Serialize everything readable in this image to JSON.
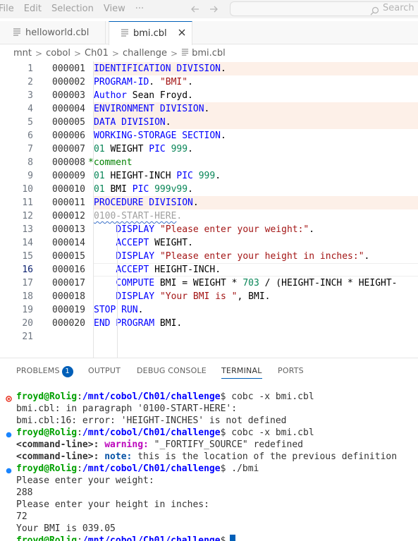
{
  "menu": {
    "items": [
      "File",
      "Edit",
      "Selection",
      "View",
      "···"
    ]
  },
  "search": {
    "placeholder": "Search"
  },
  "tabs": [
    {
      "label": "helloworld.cbl",
      "active": false
    },
    {
      "label": "bmi.cbl",
      "active": true
    }
  ],
  "breadcrumb": [
    "mnt",
    "cobol",
    "Ch01",
    "challenge",
    "bmi.cbl"
  ],
  "editor": {
    "current_line": 16,
    "lines": [
      {
        "n": "1",
        "seq": "000001",
        "segs": [
          [
            "k",
            "IDENTIFICATION DIVISION"
          ],
          [
            "t",
            "."
          ]
        ],
        "hl": true
      },
      {
        "n": "2",
        "seq": "000002",
        "segs": [
          [
            "k",
            "PROGRAM-ID"
          ],
          [
            "t",
            "."
          ],
          [
            "t",
            " "
          ],
          [
            "s",
            "\"BMI\""
          ],
          [
            "t",
            "."
          ]
        ],
        "hl": false
      },
      {
        "n": "3",
        "seq": "000003",
        "segs": [
          [
            "k",
            "Author"
          ],
          [
            "t",
            " Sean Froyd."
          ]
        ],
        "hl": false
      },
      {
        "n": "4",
        "seq": "000004",
        "segs": [
          [
            "k",
            "ENVIRONMENT DIVISION"
          ],
          [
            "t",
            "."
          ]
        ],
        "hl": true
      },
      {
        "n": "5",
        "seq": "000005",
        "segs": [
          [
            "k",
            "DATA DIVISION"
          ],
          [
            "t",
            "."
          ]
        ],
        "hl": true
      },
      {
        "n": "6",
        "seq": "000006",
        "segs": [
          [
            "k",
            "WORKING-STORAGE SECTION"
          ],
          [
            "t",
            "."
          ]
        ],
        "hl": false
      },
      {
        "n": "7",
        "seq": "000007",
        "segs": [
          [
            "n",
            "01"
          ],
          [
            "t",
            " WEIGHT "
          ],
          [
            "k",
            "PIC"
          ],
          [
            "t",
            " "
          ],
          [
            "n",
            "999"
          ],
          [
            "t",
            "."
          ]
        ],
        "hl": false
      },
      {
        "n": "8",
        "seq": "000008",
        "segs": [
          [
            "c",
            "*comment"
          ]
        ],
        "hl": false,
        "comment": true
      },
      {
        "n": "9",
        "seq": "000009",
        "segs": [
          [
            "n",
            "01"
          ],
          [
            "t",
            " HEIGHT-INCH "
          ],
          [
            "k",
            "PIC"
          ],
          [
            "t",
            " "
          ],
          [
            "n",
            "999"
          ],
          [
            "t",
            "."
          ]
        ],
        "hl": false
      },
      {
        "n": "10",
        "seq": "000010",
        "segs": [
          [
            "n",
            "01"
          ],
          [
            "t",
            " BMI "
          ],
          [
            "k",
            "PIC"
          ],
          [
            "t",
            " "
          ],
          [
            "n",
            "999v99"
          ],
          [
            "t",
            "."
          ]
        ],
        "hl": false
      },
      {
        "n": "11",
        "seq": "000011",
        "segs": [
          [
            "k",
            "PROCEDURE DIVISION"
          ],
          [
            "t",
            "."
          ]
        ],
        "hl": true
      },
      {
        "n": "12",
        "seq": "000012",
        "segs": [
          [
            "gq",
            "0100-START-HERE"
          ],
          [
            "g",
            "."
          ]
        ],
        "hl": false
      },
      {
        "n": "13",
        "seq": "000013",
        "segs": [
          [
            "t",
            "    "
          ],
          [
            "k",
            "DISPLAY"
          ],
          [
            "t",
            " "
          ],
          [
            "s",
            "\"Please enter your weight:\""
          ],
          [
            "t",
            "."
          ]
        ],
        "hl": false
      },
      {
        "n": "14",
        "seq": "000014",
        "segs": [
          [
            "t",
            "    "
          ],
          [
            "k",
            "ACCEPT"
          ],
          [
            "t",
            " WEIGHT."
          ]
        ],
        "hl": false
      },
      {
        "n": "15",
        "seq": "000015",
        "segs": [
          [
            "t",
            "    "
          ],
          [
            "k",
            "DISPLAY"
          ],
          [
            "t",
            " "
          ],
          [
            "s",
            "\"Please enter your height in inches:\""
          ],
          [
            "t",
            "."
          ]
        ],
        "hl": false
      },
      {
        "n": "16",
        "seq": "000016",
        "segs": [
          [
            "t",
            "    "
          ],
          [
            "k",
            "ACCEPT"
          ],
          [
            "t",
            " HEIGHT-INCH."
          ]
        ],
        "hl": false
      },
      {
        "n": "17",
        "seq": "000017",
        "segs": [
          [
            "t",
            "    "
          ],
          [
            "k",
            "COMPUTE"
          ],
          [
            "t",
            " BMI = WEIGHT * "
          ],
          [
            "n",
            "703"
          ],
          [
            "t",
            " / ("
          ],
          [
            "t",
            "HEIGHT-INCH * HEIGHT-"
          ]
        ],
        "hl": false
      },
      {
        "n": "18",
        "seq": "000018",
        "segs": [
          [
            "t",
            "    "
          ],
          [
            "k",
            "DISPLAY"
          ],
          [
            "t",
            " "
          ],
          [
            "s",
            "\"Your BMI is \""
          ],
          [
            "t",
            ", BMI."
          ]
        ],
        "hl": false
      },
      {
        "n": "19",
        "seq": "000019",
        "segs": [
          [
            "k",
            "STOP RUN"
          ],
          [
            "t",
            "."
          ]
        ],
        "hl": false
      },
      {
        "n": "20",
        "seq": "000020",
        "segs": [
          [
            "k",
            "END PROGRAM"
          ],
          [
            "t",
            " BMI."
          ]
        ],
        "hl": false
      },
      {
        "n": "21",
        "seq": "",
        "segs": [],
        "hl": false
      }
    ]
  },
  "panel": {
    "tabs": [
      {
        "label": "PROBLEMS",
        "badge": "1"
      },
      {
        "label": "OUTPUT"
      },
      {
        "label": "DEBUG CONSOLE"
      },
      {
        "label": "TERMINAL",
        "active": true
      },
      {
        "label": "PORTS"
      }
    ],
    "terminal": {
      "lines": [
        {
          "dot": "error",
          "segs": [
            [
              "user",
              "froyd@Rolig"
            ],
            [
              "t",
              ":"
            ],
            [
              "path",
              "/mnt/cobol/Ch01/challenge"
            ],
            [
              "t",
              "$ cobc -x bmi.cbl"
            ]
          ]
        },
        {
          "segs": [
            [
              "t",
              "bmi.cbl: in paragraph '0100-START-HERE':"
            ]
          ]
        },
        {
          "segs": [
            [
              "t",
              "bmi.cbl:16: error: 'HEIGHT-INCHES' is not defined"
            ]
          ]
        },
        {
          "dot": "info",
          "segs": [
            [
              "user",
              "froyd@Rolig"
            ],
            [
              "t",
              ":"
            ],
            [
              "path",
              "/mnt/cobol/Ch01/challenge"
            ],
            [
              "t",
              "$ cobc -x bmi.cbl"
            ]
          ]
        },
        {
          "segs": [
            [
              "bold",
              "<command-line>:"
            ],
            [
              "t",
              " "
            ],
            [
              "warn",
              "warning:"
            ],
            [
              "t",
              " \"_FORTIFY_SOURCE\" redefined"
            ]
          ]
        },
        {
          "segs": [
            [
              "bold",
              "<command-line>:"
            ],
            [
              "t",
              " "
            ],
            [
              "note",
              "note:"
            ],
            [
              "t",
              " this is the location of the previous definition"
            ]
          ]
        },
        {
          "dot": "info",
          "segs": [
            [
              "user",
              "froyd@Rolig"
            ],
            [
              "t",
              ":"
            ],
            [
              "path",
              "/mnt/cobol/Ch01/challenge"
            ],
            [
              "t",
              "$ ./bmi"
            ]
          ]
        },
        {
          "segs": [
            [
              "t",
              "Please enter your weight:"
            ]
          ]
        },
        {
          "segs": [
            [
              "t",
              "288"
            ]
          ]
        },
        {
          "segs": [
            [
              "t",
              "Please enter your height in inches:"
            ]
          ]
        },
        {
          "segs": [
            [
              "t",
              "72"
            ]
          ]
        },
        {
          "segs": [
            [
              "t",
              "Your BMI is 039.05"
            ]
          ]
        },
        {
          "segs": [
            [
              "user",
              "froyd@Rolig"
            ],
            [
              "t",
              ":"
            ],
            [
              "path",
              "/mnt/cobol/Ch01/challenge"
            ],
            [
              "t",
              "$"
            ]
          ],
          "cursor": true
        }
      ]
    }
  },
  "colors": {
    "accent": "#005fb8",
    "keyword": "#0000ff",
    "string": "#a31515",
    "number": "#098658",
    "comment": "#008000",
    "error_dot": "#e51400",
    "info_dot": "#1a85ff"
  }
}
